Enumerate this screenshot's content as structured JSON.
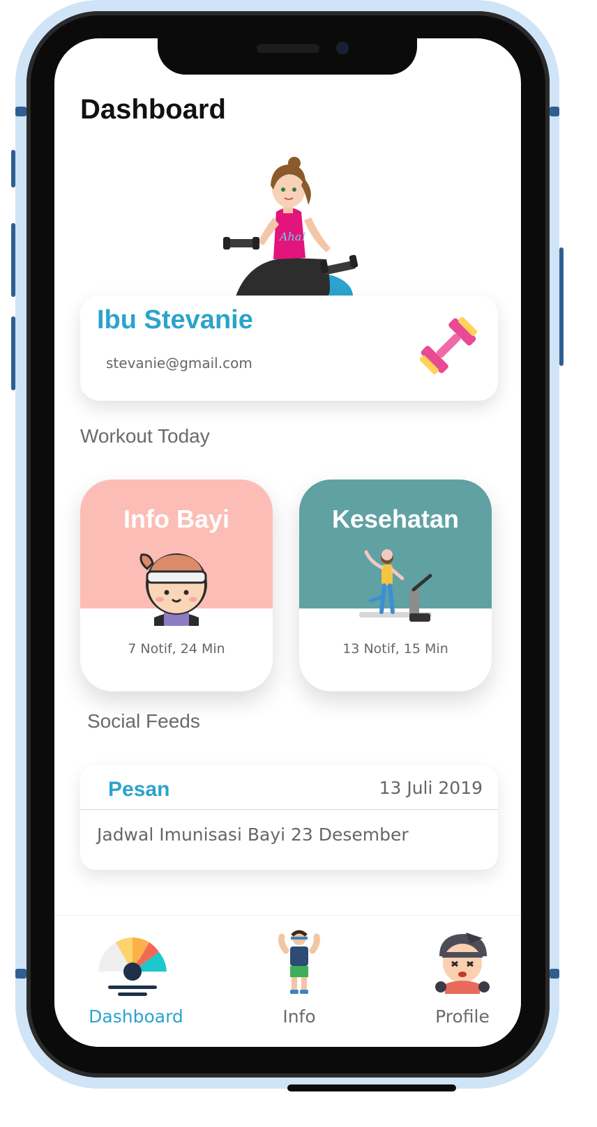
{
  "page": {
    "title": "Dashboard"
  },
  "profile": {
    "name": "Ibu Stevanie",
    "email": "stevanie@gmail.com"
  },
  "sections": {
    "workout": "Workout Today",
    "social": "Social Feeds"
  },
  "tiles": [
    {
      "title": "Info Bayi",
      "stats": "7 Notif,  24 Min",
      "color": "#fcbdb6",
      "icon": "baby-face-icon"
    },
    {
      "title": "Kesehatan",
      "stats": "13 Notif,  15 Min",
      "color": "#60a1a3",
      "icon": "treadmill-icon"
    }
  ],
  "feed": {
    "tag": "Pesan",
    "date": "13 Juli 2019",
    "message": "Jadwal Imunisasi Bayi 23 Desember"
  },
  "nav": [
    {
      "label": "Dashboard",
      "icon": "gauge-icon",
      "active": true
    },
    {
      "label": "Info",
      "icon": "strongman-icon",
      "active": false
    },
    {
      "label": "Profile",
      "icon": "angry-avatar-icon",
      "active": false
    }
  ],
  "colors": {
    "accent": "#2ba3cc",
    "frame": "#cfe4f6"
  }
}
